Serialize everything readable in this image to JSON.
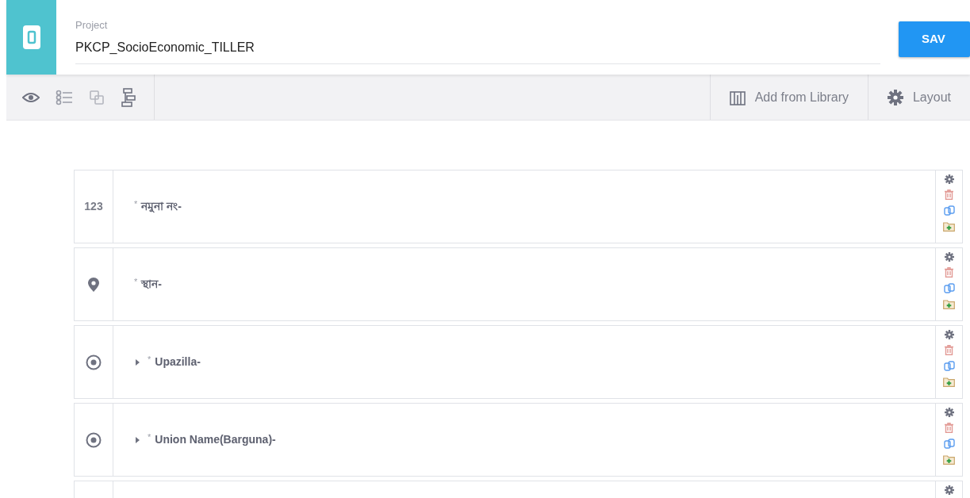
{
  "header": {
    "field_label": "Project",
    "project_name": "PKCP_SocioEconomic_TILLER",
    "save_button": "SAV"
  },
  "toolbar": {
    "icons": [
      {
        "kind": "eye"
      },
      {
        "kind": "list"
      },
      {
        "kind": "copy"
      },
      {
        "kind": "flow"
      }
    ],
    "actions": [
      {
        "kind": "library",
        "label": "Add from Library"
      },
      {
        "kind": "gear",
        "label": "Layout"
      }
    ]
  },
  "questions": [
    {
      "kind": "number",
      "icon_text": "123",
      "mark": "*",
      "label": "নমুনা নং-"
    },
    {
      "kind": "location",
      "mark": "*",
      "label": "স্থান-"
    },
    {
      "kind": "select",
      "expanded": false,
      "mark": "*",
      "label": "Upazilla-"
    },
    {
      "kind": "select",
      "expanded": false,
      "mark": "*",
      "label": "Union Name(Barguna)-"
    },
    {
      "kind": "blank"
    }
  ]
}
